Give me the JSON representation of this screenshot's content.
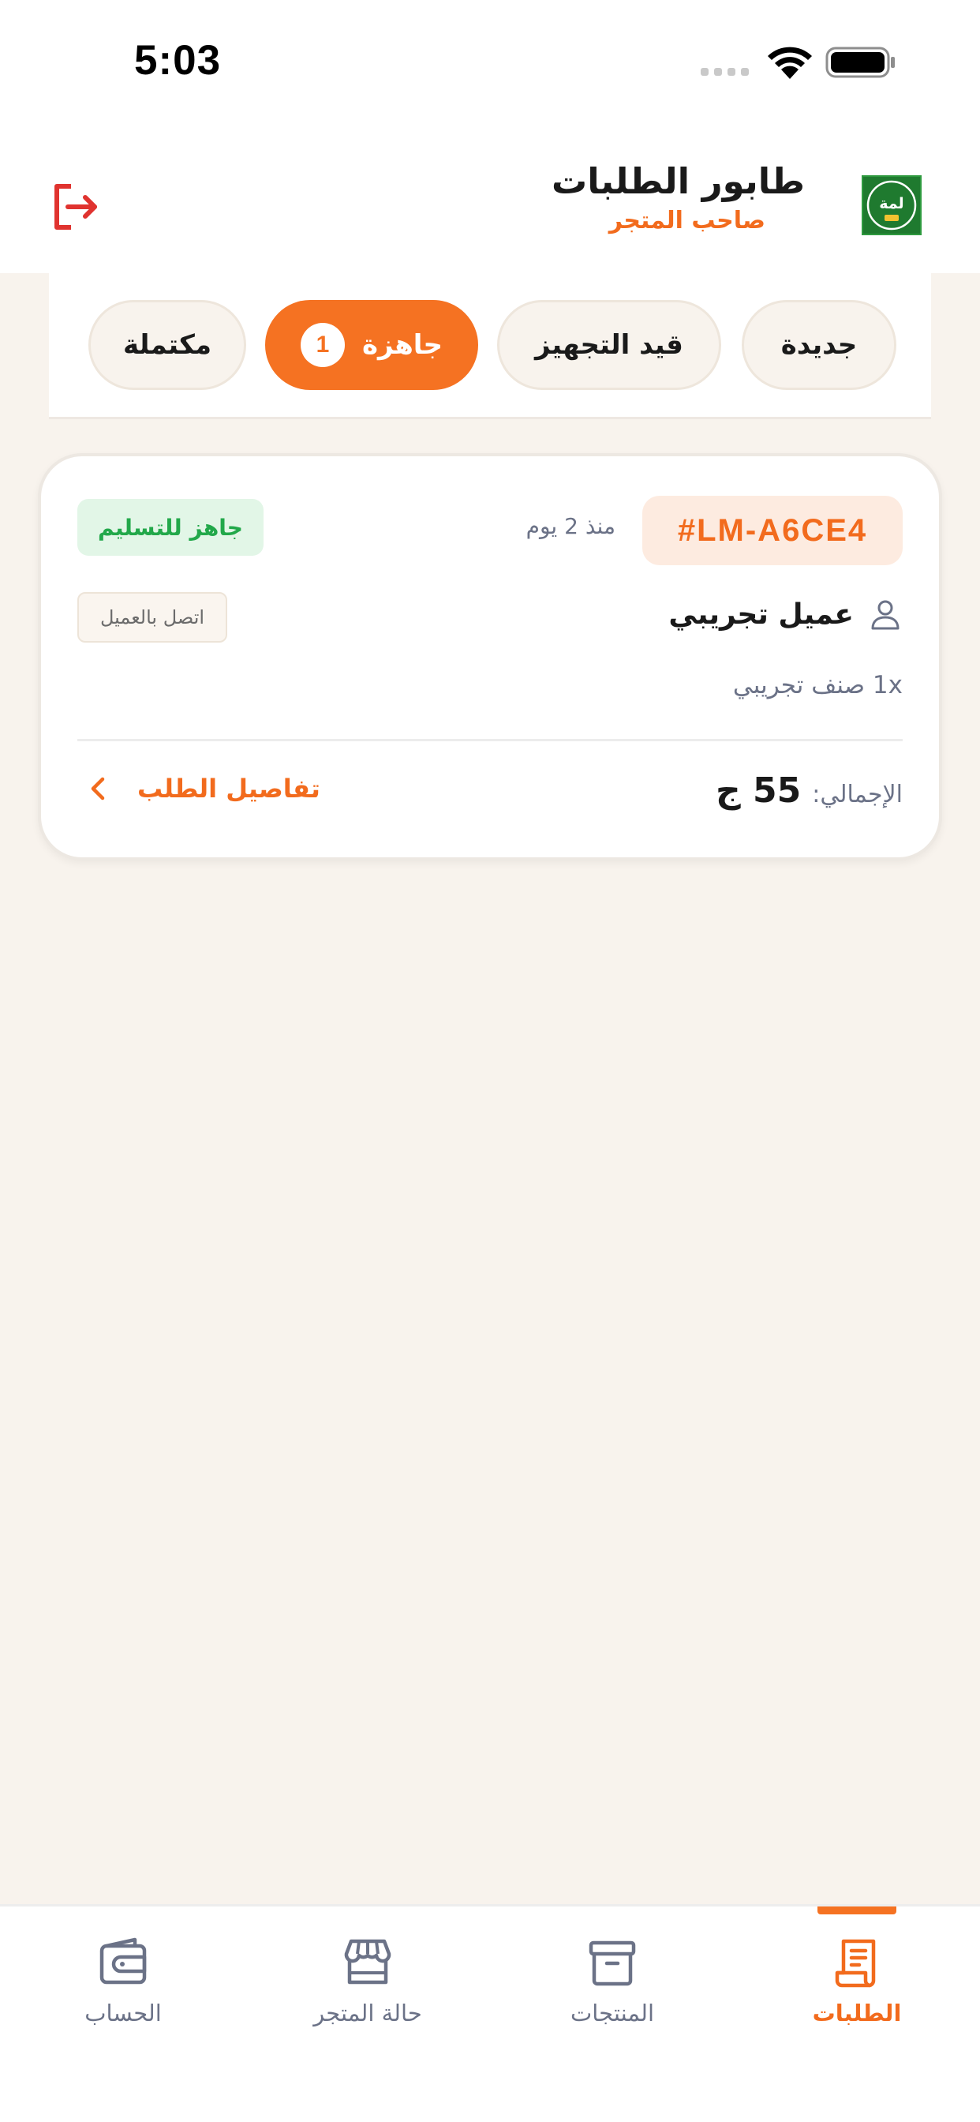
{
  "status_bar": {
    "time": "5:03"
  },
  "header": {
    "title": "طابور الطلبات",
    "subtitle": "صاحب المتجر",
    "logo_text": "لمة",
    "logout_icon": "logout-icon"
  },
  "tabs": [
    {
      "label": "جديدة",
      "active": false
    },
    {
      "label": "قيد التجهيز",
      "active": false
    },
    {
      "label": "جاهزة",
      "active": true,
      "badge": "1"
    },
    {
      "label": "مكتملة",
      "active": false
    }
  ],
  "order": {
    "id": "#LM-A6CE4",
    "age": "منذ 2 يوم",
    "status": "جاهز للتسليم",
    "customer_name": "عميل تجريبي",
    "contact_label": "اتصل بالعميل",
    "item": "1x صنف تجريبي",
    "total_label": "الإجمالي:",
    "total_value": "55 ج",
    "details_label": "تفاصيل الطلب"
  },
  "bottom_nav": [
    {
      "label": "الطلبات",
      "icon": "receipt-icon",
      "active": true
    },
    {
      "label": "المنتجات",
      "icon": "archive-box-icon",
      "active": false
    },
    {
      "label": "حالة المتجر",
      "icon": "storefront-icon",
      "active": false
    },
    {
      "label": "الحساب",
      "icon": "wallet-icon",
      "active": false
    }
  ],
  "colors": {
    "accent": "#F57222",
    "background": "#F8F3ED",
    "success": "#22A84A",
    "danger": "#E0332F"
  }
}
